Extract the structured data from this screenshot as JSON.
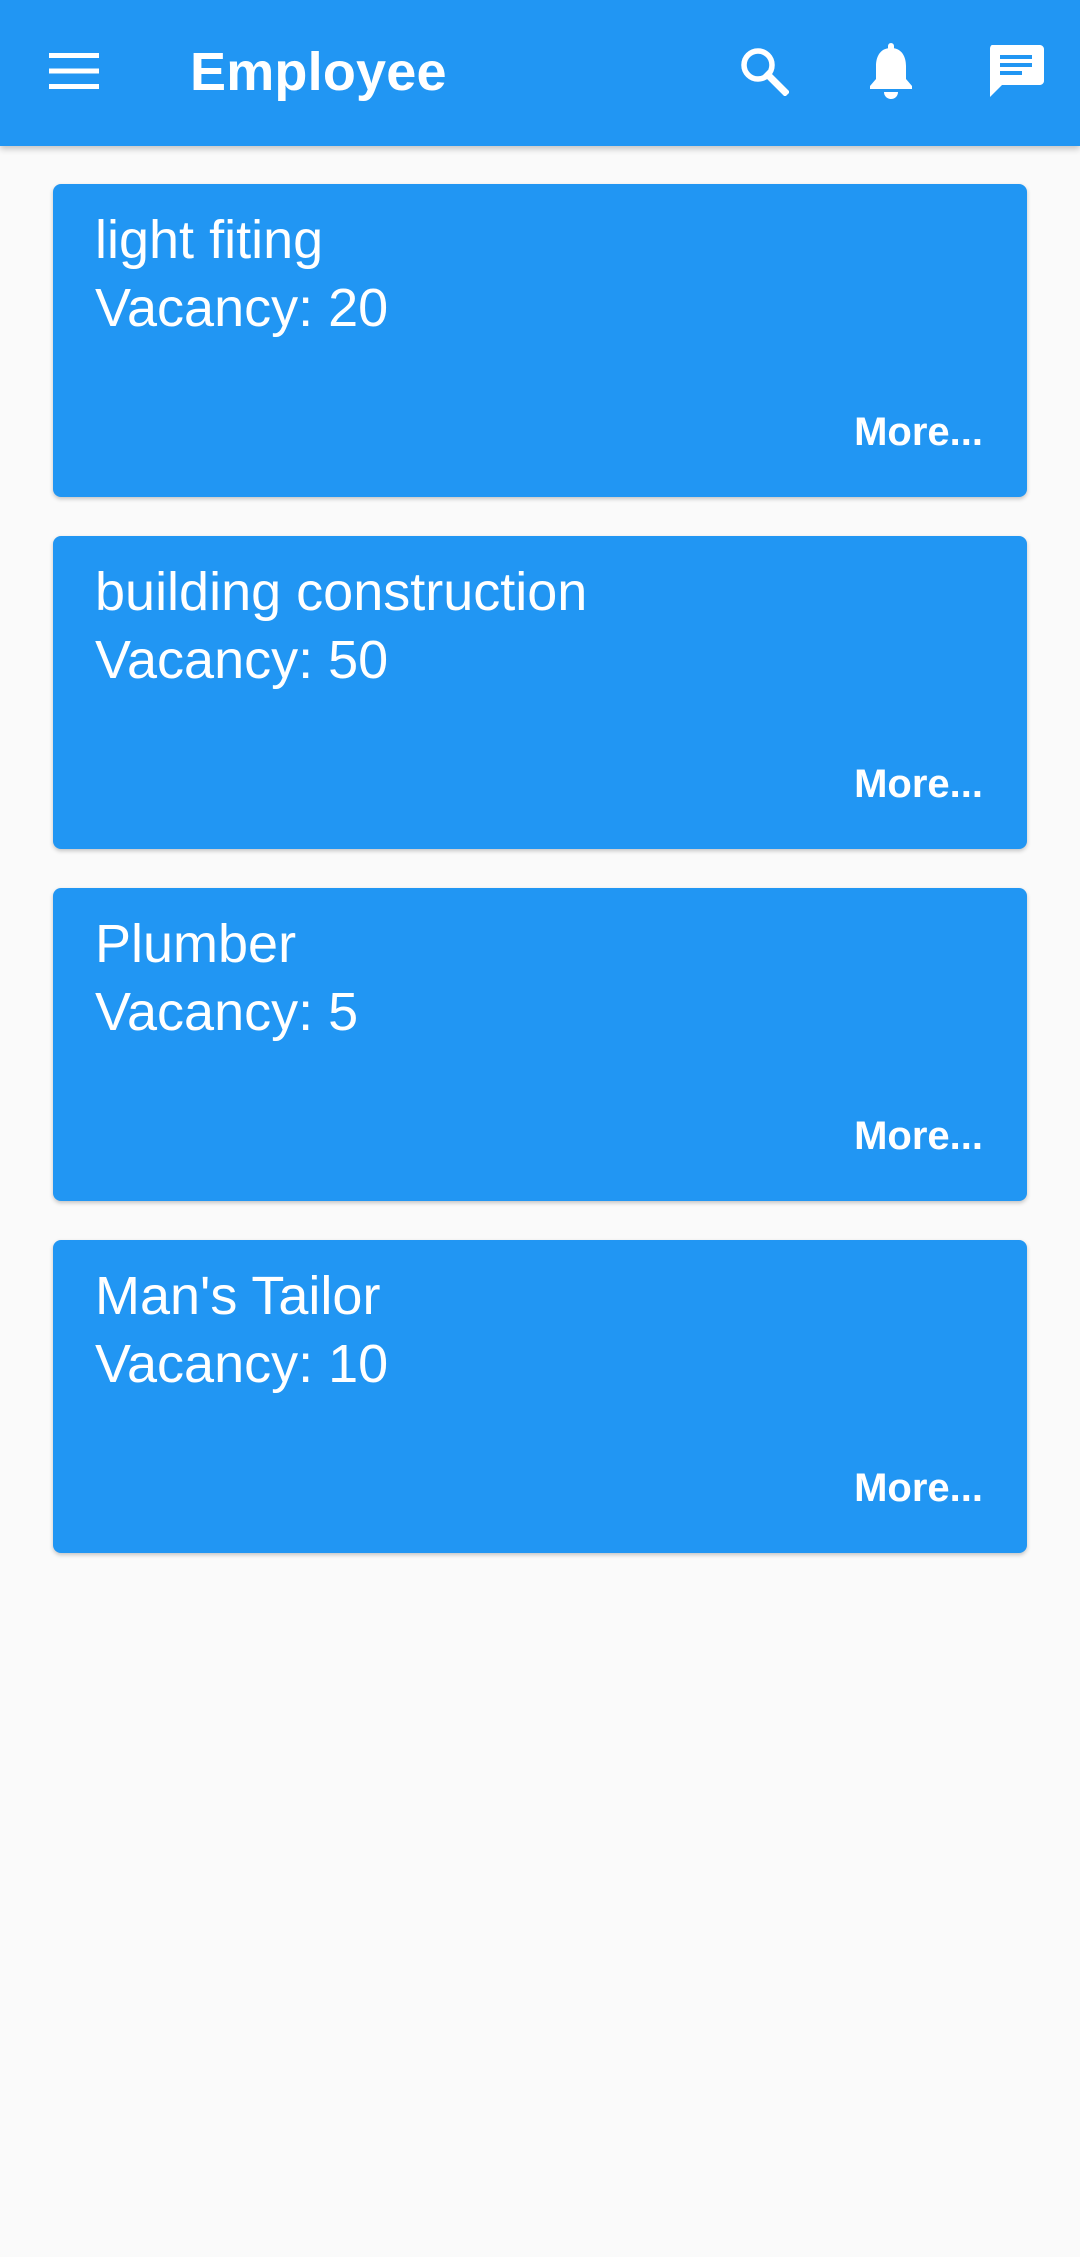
{
  "app_bar": {
    "title": "Employee",
    "background": "#2196f3",
    "icons": {
      "menu": "menu-icon",
      "search": "search-icon",
      "notifications": "bell-icon",
      "messages": "chat-icon"
    }
  },
  "jobs": [
    {
      "title": "light fiting",
      "vacancy": "Vacancy: 20",
      "more": "More..."
    },
    {
      "title": "building construction",
      "vacancy": "Vacancy: 50",
      "more": "More..."
    },
    {
      "title": "Plumber",
      "vacancy": "Vacancy: 5",
      "more": "More..."
    },
    {
      "title": "Man's Tailor",
      "vacancy": "Vacancy: 10",
      "more": "More..."
    }
  ],
  "colors": {
    "accent": "#2196f3",
    "background": "#fafafa",
    "text_on_accent": "#ffffff"
  }
}
